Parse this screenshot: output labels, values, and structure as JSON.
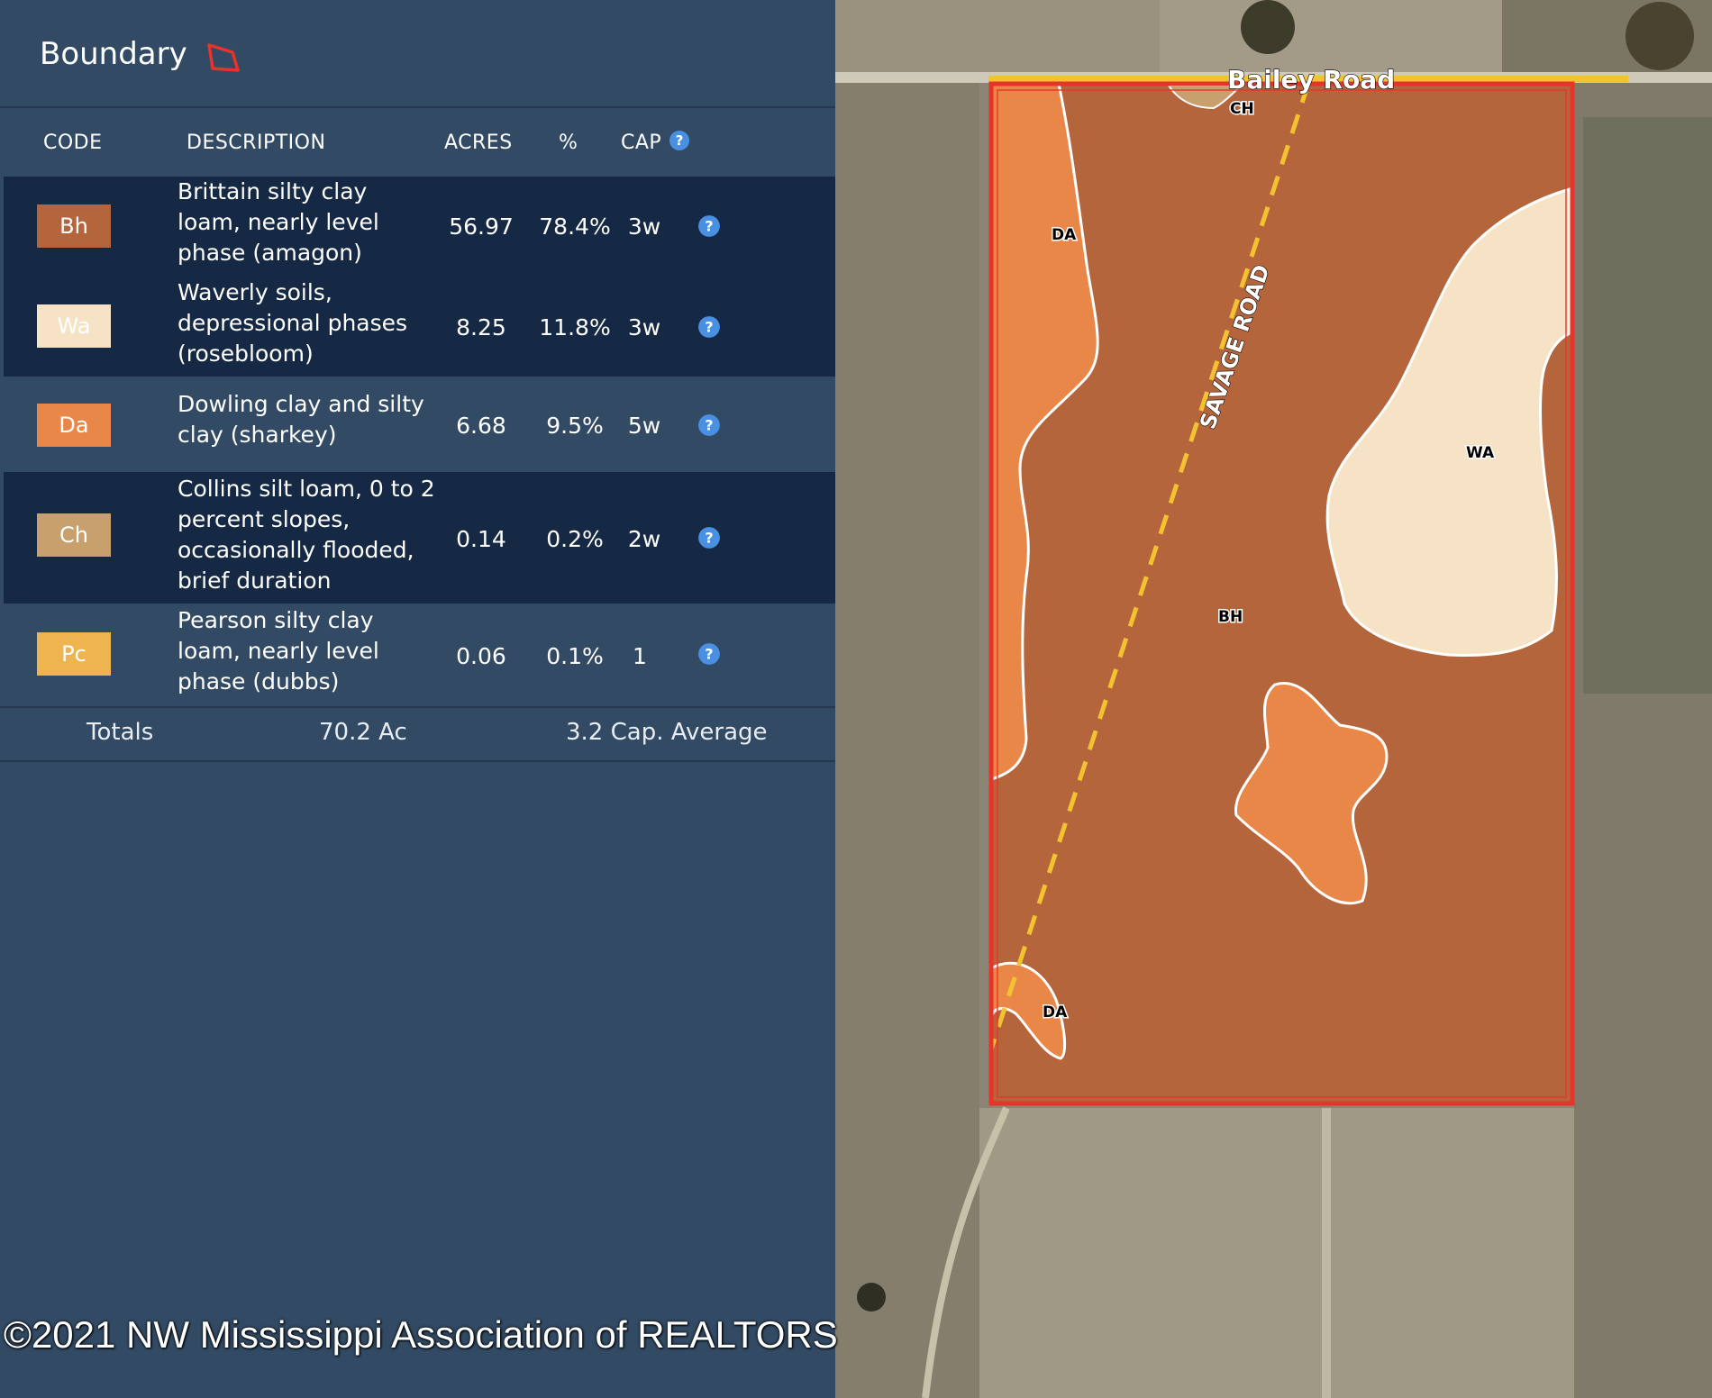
{
  "panel": {
    "title": "Boundary",
    "columns": {
      "code": "CODE",
      "description": "DESCRIPTION",
      "acres": "ACRES",
      "percent": "%",
      "cap": "CAP"
    },
    "rows": [
      {
        "code": "Bh",
        "desc_lines": [
          "Brittain silty clay",
          "loam, nearly level",
          "phase (amagon)"
        ],
        "acres": "56.97",
        "percent": "78.4%",
        "cap": "3w",
        "color": "#b5653c",
        "text_color": "#ffffff"
      },
      {
        "code": "Wa",
        "desc_lines": [
          "Waverly soils,",
          "depressional phases",
          "(rosebloom)"
        ],
        "acres": "8.25",
        "percent": "11.8%",
        "cap": "3w",
        "color": "#f6e3c5",
        "text_color": "#ffffff"
      },
      {
        "code": "Da",
        "desc_lines": [
          "Dowling clay and silty",
          "clay (sharkey)"
        ],
        "acres": "6.68",
        "percent": "9.5%",
        "cap": "5w",
        "color": "#e98749",
        "text_color": "#ffffff"
      },
      {
        "code": "Ch",
        "desc_lines": [
          "Collins silt loam, 0 to 2",
          "percent slopes,",
          "occasionally flooded,",
          "brief duration"
        ],
        "acres": "0.14",
        "percent": "0.2%",
        "cap": "2w",
        "color": "#c8a06d",
        "text_color": "#ffffff"
      },
      {
        "code": "Pc",
        "desc_lines": [
          "Pearson silty clay",
          "loam, nearly level",
          "phase (dubbs)"
        ],
        "acres": "0.06",
        "percent": "0.1%",
        "cap": "1",
        "color": "#edb44f",
        "text_color": "#ffffff"
      }
    ],
    "totals": {
      "label": "Totals",
      "acres": "70.2 Ac",
      "cap_average": "3.2 Cap. Average"
    }
  },
  "map": {
    "road_labels": {
      "bailey": "Bailey Road",
      "savage": "SAVAGE ROAD"
    },
    "soil_labels": [
      "CH",
      "DA",
      "WA",
      "BH",
      "DA"
    ],
    "boundary_color": "#e8332b",
    "road_line_color": "#f2c230"
  },
  "watermark": "©2021 NW Mississippi Association of REALTORS"
}
